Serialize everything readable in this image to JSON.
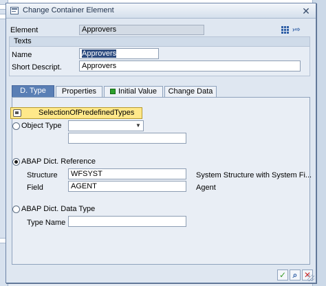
{
  "window": {
    "title": "Change Container Element"
  },
  "header": {
    "element_label": "Element",
    "element_value": "Approvers"
  },
  "texts_group": {
    "title": "Texts",
    "name_label": "Name",
    "name_value": "Approvers",
    "short_label": "Short Descript.",
    "short_value": "Approvers"
  },
  "tabs": [
    {
      "label": "D. Type",
      "active": true
    },
    {
      "label": "Properties",
      "active": false
    },
    {
      "label": "Initial Value",
      "active": false
    },
    {
      "label": "Change Data",
      "active": false
    }
  ],
  "dtype": {
    "selection_button": "SelectionOfPredefinedTypes",
    "object_type_label": "Object Type",
    "object_type_value": "",
    "object_type_extra": "",
    "abap_dict_ref_label": "ABAP Dict. Reference",
    "structure_label": "Structure",
    "structure_value": "WFSYST",
    "structure_desc": "System Structure with System Fi...",
    "field_label": "Field",
    "field_value": "AGENT",
    "field_desc": "Agent",
    "abap_dict_type_label": "ABAP Dict. Data Type",
    "type_name_label": "Type Name",
    "type_name_value": ""
  },
  "selected_radio": "abap_dict_reference",
  "toolbar": {
    "ok_icon": "check-icon",
    "search_icon": "magnifier-icon",
    "cancel_icon": "cross-icon"
  },
  "colors": {
    "active_tab": "#5a7fb5",
    "yellow_button": "#ffe88a",
    "ok_green": "#3a9a2a",
    "cancel_red": "#cc2a2a"
  }
}
